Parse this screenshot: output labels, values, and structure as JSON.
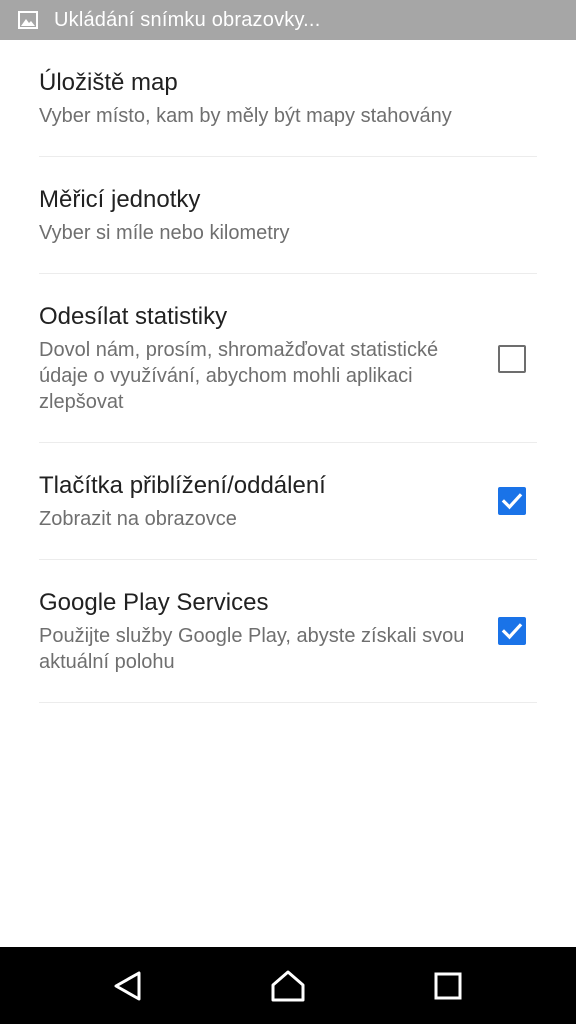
{
  "status_bar": {
    "notification_icon": "image-icon",
    "text": "Ukládání snímku obrazovky..."
  },
  "settings": [
    {
      "title": "Úložiště map",
      "summary": "Vyber místo, kam by měly být mapy stahovány",
      "checkbox": null
    },
    {
      "title": "Měřicí jednotky",
      "summary": "Vyber si míle nebo kilometry",
      "checkbox": null
    },
    {
      "title": "Odesílat statistiky",
      "summary": "Dovol nám, prosím, shromažďovat statistické údaje o využívání, abychom mohli aplikaci zlepšovat",
      "checkbox": false
    },
    {
      "title": "Tlačítka přiblížení/oddálení",
      "summary": "Zobrazit na obrazovce",
      "checkbox": true
    },
    {
      "title": "Google Play Services",
      "summary": "Použijte služby Google Play, abyste získali svou aktuální polohu",
      "checkbox": true
    }
  ],
  "colors": {
    "status_bar": "#a6a6a6",
    "checkbox_checked": "#1a73e8",
    "title_text": "#212121",
    "summary_text": "#6f6f6f",
    "nav_bar": "#000000"
  },
  "nav_bar": {
    "back_icon": "back-triangle-icon",
    "home_icon": "home-icon",
    "recents_icon": "recents-square-icon"
  }
}
